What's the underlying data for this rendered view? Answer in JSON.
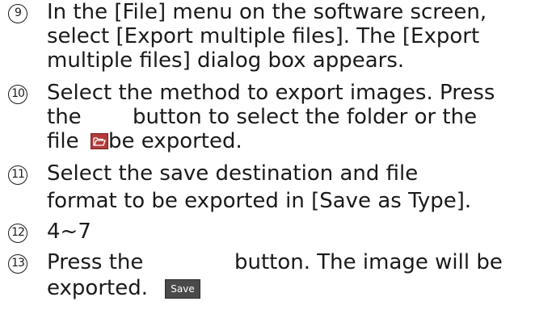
{
  "steps": [
    {
      "number": "9",
      "lines": [
        "In the [File] menu on the software screen,",
        "select [Export multiple files]. The [Export",
        "multiple files] dialog box appears."
      ]
    },
    {
      "number": "10",
      "lines": [
        "Select the method to export images. Press",
        "the",
        "button to select the folder or the",
        "file",
        "be exported."
      ]
    },
    {
      "number": "11",
      "lines": [
        "Select the save destination and file",
        "format to be exported in [Save as Type]."
      ]
    },
    {
      "number": "12",
      "lines": [
        "4~7"
      ]
    },
    {
      "number": "13",
      "lines": [
        "Press the",
        "button. The image will be",
        "exported."
      ]
    }
  ],
  "icons": {
    "folder_icon": "folder-open-icon",
    "folder_icon_color": "#b23b3b"
  },
  "buttons": {
    "save_label": "Save"
  }
}
